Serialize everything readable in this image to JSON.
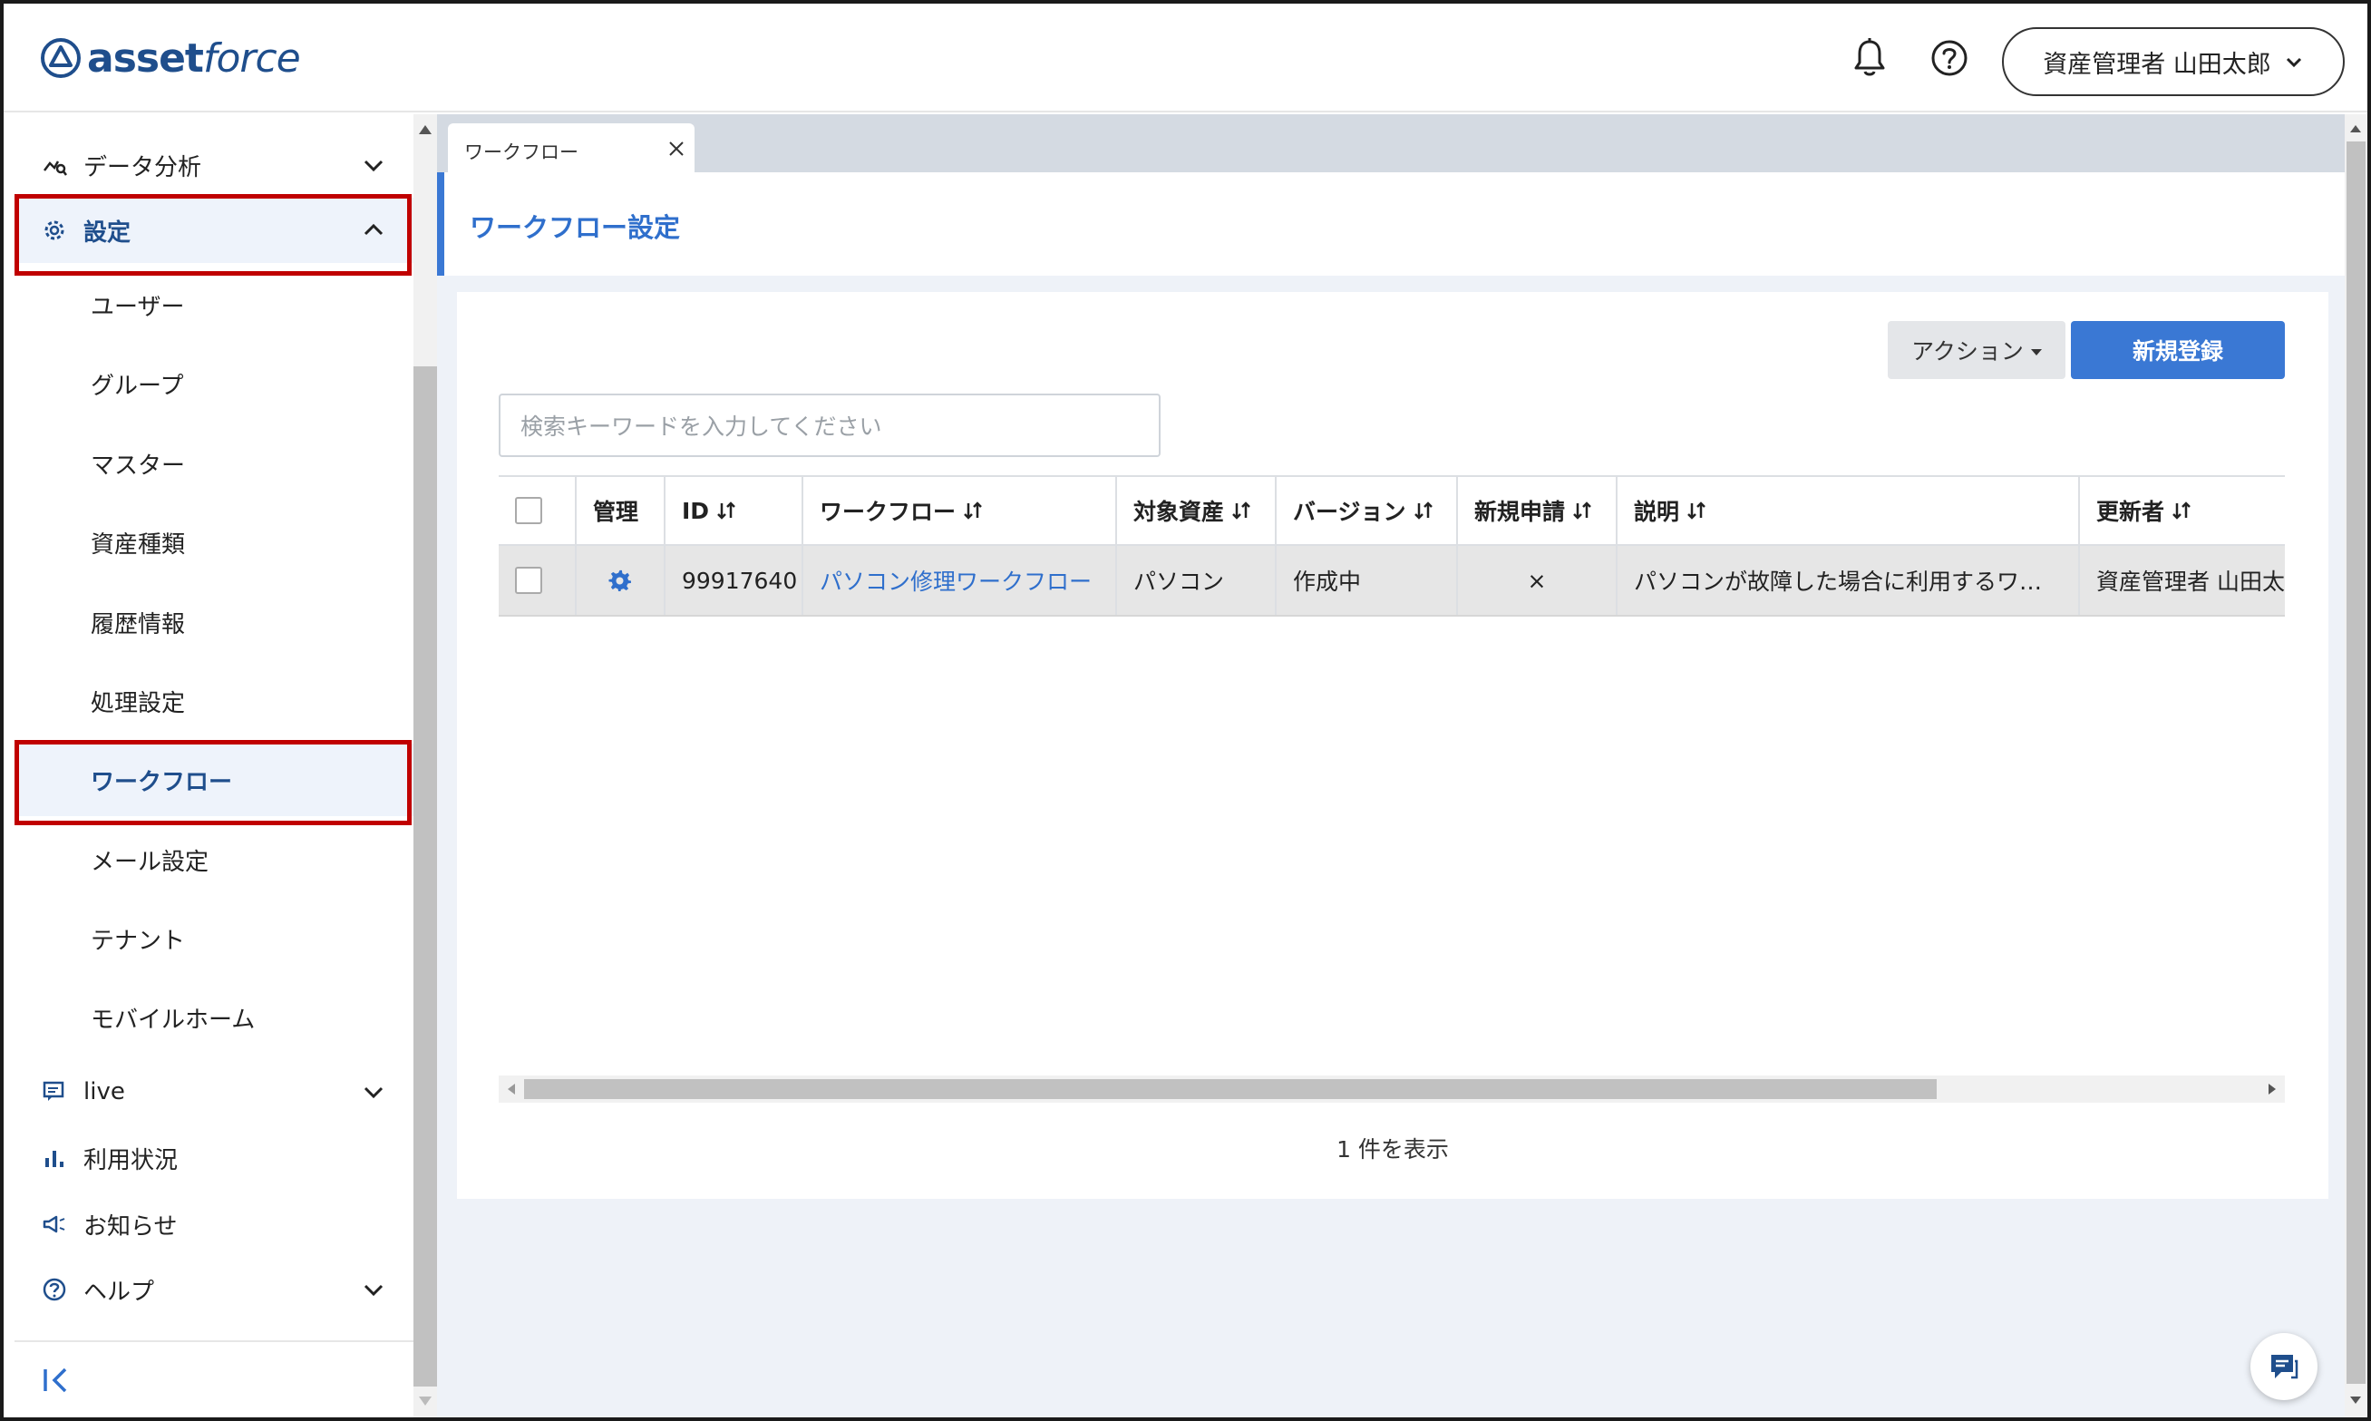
{
  "app": {
    "logo_text_bold": "asset",
    "logo_text_italic": "force"
  },
  "header": {
    "user_name": "資産管理者 山田太郎"
  },
  "sidebar": {
    "data_analysis": "データ分析",
    "settings": "設定",
    "sub_items": [
      "ユーザー",
      "グループ",
      "マスター",
      "資産種類",
      "履歴情報",
      "処理設定",
      "ワークフロー",
      "メール設定",
      "テナント",
      "モバイルホーム"
    ],
    "active_sub_item": "ワークフロー",
    "live": "live",
    "usage": "利用状況",
    "notice": "お知らせ",
    "help": "ヘルプ"
  },
  "main": {
    "tab_label": "ワークフロー",
    "page_title": "ワークフロー設定",
    "action_button": "アクション",
    "new_button": "新規登録",
    "search_placeholder": "検索キーワードを入力してください",
    "columns": [
      "管理",
      "ID",
      "ワークフロー",
      "対象資産",
      "バージョン",
      "新規申請",
      "説明",
      "更新者"
    ],
    "rows": [
      {
        "id": "99917640",
        "workflow": "パソコン修理ワークフロー",
        "target_asset": "パソコン",
        "version": "作成中",
        "new_application": "×",
        "description": "パソコンが故障した場合に利用するワ…",
        "updated_by": "資産管理者 山田太"
      }
    ],
    "count_text": "1 件を表示"
  },
  "colors": {
    "brand": "#1f4e8c",
    "accent": "#3a78d4",
    "highlight_box": "#c00000"
  }
}
